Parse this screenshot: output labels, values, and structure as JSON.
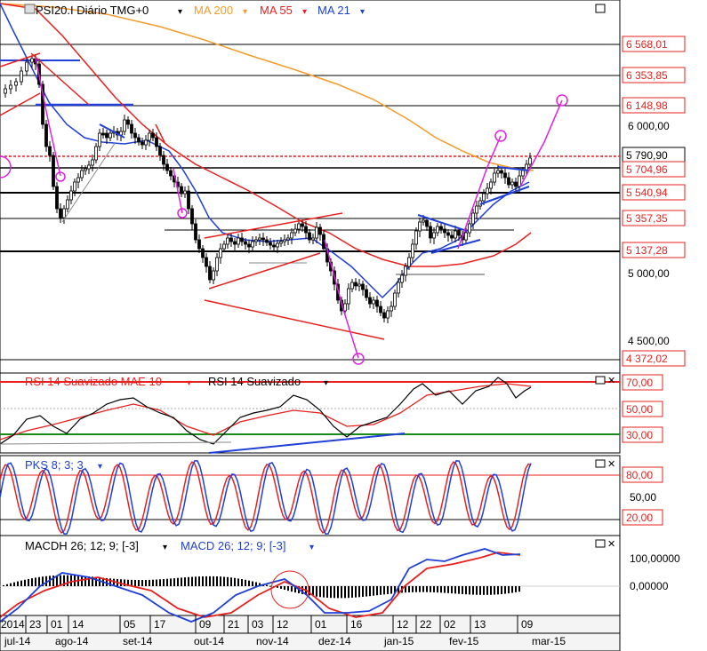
{
  "main": {
    "instrument": "PSI20.I Diário TMG+0",
    "indicators": [
      {
        "label": "MA 200",
        "color": "#f39c2a"
      },
      {
        "label": "MA 55",
        "color": "#e8211e"
      },
      {
        "label": "MA 21",
        "color": "#1f3fd8"
      }
    ]
  },
  "price_axis": {
    "ticks": [
      "6 000,00",
      "5 000,00",
      "4 500,00"
    ],
    "level_labels": [
      "6 568,01",
      "6 353,85",
      "6 148,98",
      "5 790,90",
      "5 704,96",
      "5 540,94",
      "5 357,35",
      "5 137,28",
      "4 372,02"
    ]
  },
  "rsi": {
    "title_1": "RSI 14 Suavizado MAE 10",
    "title_2": "RSI 14 Suavizado",
    "levels": [
      "70,00",
      "50,00",
      "30,00"
    ]
  },
  "stoch": {
    "title": "PKS 8; 3; 3",
    "levels": [
      "80,00",
      "50,00",
      "20,00"
    ]
  },
  "macd": {
    "title_1": "MACDH 26; 12; 9; [-3]",
    "title_2": "MACD 26; 12; 9; [-3]",
    "levels": [
      "100,00000",
      "0,00000"
    ]
  },
  "time_axis": {
    "days": [
      "2014",
      "23",
      "01",
      "14",
      "05",
      "17",
      "09",
      "21",
      "03",
      "12",
      "01",
      "16",
      "12",
      "22",
      "02",
      "13",
      "09"
    ],
    "months": [
      "jul-14",
      "ago-14",
      "set-14",
      "out-14",
      "nov-14",
      "dez-14",
      "jan-15",
      "fev-15",
      "mar-15"
    ]
  },
  "chart_data": [
    {
      "type": "candlestick",
      "title": "PSI20.I Diário TMG+0",
      "ylim": [
        4350,
        6700
      ],
      "log_scale": true,
      "support_resistance_levels": [
        6568.01,
        6353.85,
        6148.98,
        5704.96,
        5540.94,
        5357.35,
        5137.28
      ],
      "last_price": 5790.9,
      "projection_targets": [
        6148.98,
        4372.02
      ],
      "series": [
        {
          "name": "MA 200",
          "values": [
            6880,
            6820,
            6760,
            6700,
            6630,
            6560,
            6480,
            6390,
            6300,
            6200,
            6100,
            5980,
            5860,
            5760,
            5700,
            5680
          ]
        },
        {
          "name": "MA 55",
          "values": [
            6900,
            6700,
            6400,
            6100,
            5850,
            5600,
            5400,
            5280,
            5150,
            5010,
            4990,
            5050,
            5120,
            5140,
            5137,
            5290
          ]
        },
        {
          "name": "MA 21",
          "values": [
            6880,
            6200,
            5700,
            5750,
            5850,
            5600,
            5200,
            5150,
            5180,
            4980,
            4760,
            4850,
            5150,
            5280,
            5460,
            5620
          ]
        }
      ]
    },
    {
      "type": "line",
      "title": "RSI 14 Suavizado MAE 10",
      "ylim": [
        15,
        80
      ],
      "levels": [
        70,
        50,
        30
      ],
      "series": [
        {
          "name": "RSI 14 Suavizado MAE 10",
          "values": [
            28,
            32,
            45,
            52,
            58,
            50,
            38,
            42,
            48,
            44,
            36,
            38,
            55,
            62,
            66,
            68
          ]
        },
        {
          "name": "RSI 14 Suavizado",
          "values": [
            25,
            30,
            44,
            55,
            60,
            48,
            28,
            45,
            52,
            46,
            32,
            40,
            60,
            66,
            62,
            70
          ]
        }
      ]
    },
    {
      "type": "line",
      "title": "PKS 8; 3; 3",
      "ylim": [
        0,
        100
      ],
      "levels": [
        80,
        50,
        20
      ],
      "series": [
        {
          "name": "PKS 8; 3; 3",
          "values": [
            20,
            85,
            30,
            70,
            40,
            80,
            15,
            85,
            60,
            80,
            10,
            85,
            40,
            85,
            30,
            90
          ]
        }
      ]
    },
    {
      "type": "line",
      "title": "MACD 26; 12; 9; [-3]",
      "ylim": [
        -200,
        150
      ],
      "levels": [
        100,
        0
      ],
      "series": [
        {
          "name": "MACD 26; 12; 9; [-3]",
          "values": [
            -150,
            -190,
            -60,
            10,
            20,
            -120,
            -180,
            -40,
            30,
            -110,
            -170,
            20,
            90,
            110,
            90,
            120
          ]
        },
        {
          "name": "MACDH 26; 12; 9; [-3]",
          "values": [
            -20,
            40,
            40,
            20,
            10,
            -20,
            20,
            20,
            10,
            -15,
            10,
            20,
            15,
            5,
            5,
            5
          ]
        }
      ]
    }
  ]
}
